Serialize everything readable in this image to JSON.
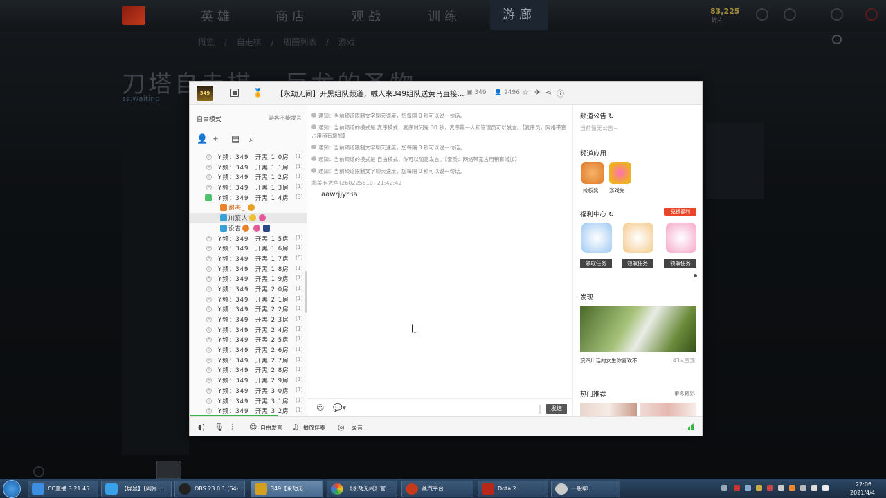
{
  "game": {
    "nav": [
      "英雄",
      "商店",
      "观战",
      "训练",
      "游廊"
    ],
    "active_nav": "游廊",
    "currency": "83,225",
    "currency_sub": "碎片",
    "breadcrumb": "概览 / 自走棋 / 周围列表 / 游戏",
    "title": "刀塔自走棋 - 巨龙的圣物",
    "subtitle": "ss.waiting"
  },
  "chat": {
    "channel_logo_text": "349",
    "channel_title": "【永劫无间】开黑组队频道，喊人来349组队送黄马直接...",
    "channel_id": "349",
    "online_count": "2496",
    "mode_label": "自由模式",
    "guest_label": "游客不能发言",
    "tree_rows": [
      {
        "name": "Y频：349　开黑 1 0房",
        "count": "(1)"
      },
      {
        "name": "Y频：349　开黑 1 1房",
        "count": "(1)"
      },
      {
        "name": "Y频：349　开黑 1 2房",
        "count": "(1)"
      },
      {
        "name": "Y频：349　开黑 1 3房",
        "count": "(1)"
      },
      {
        "name": "Y频：349　开黑 1 4房",
        "count": "(3)"
      },
      {
        "name": "谢老_",
        "count": ""
      },
      {
        "name": "川菜人",
        "count": ""
      },
      {
        "name": "设吉",
        "count": ""
      },
      {
        "name": "Y频：349　开黑 1 5房",
        "count": "(1)"
      },
      {
        "name": "Y频：349　开黑 1 6房",
        "count": "(1)"
      },
      {
        "name": "Y频：349　开黑 1 7房",
        "count": "(5)"
      },
      {
        "name": "Y频：349　开黑 1 8房",
        "count": "(1)"
      },
      {
        "name": "Y频：349　开黑 1 9房",
        "count": "(1)"
      },
      {
        "name": "Y频：349　开黑 2 0房",
        "count": "(1)"
      },
      {
        "name": "Y频：349　开黑 2 1房",
        "count": "(1)"
      },
      {
        "name": "Y频：349　开黑 2 2房",
        "count": "(1)"
      },
      {
        "name": "Y频：349　开黑 2 3房",
        "count": "(1)"
      },
      {
        "name": "Y频：349　开黑 2 4房",
        "count": "(1)"
      },
      {
        "name": "Y频：349　开黑 2 5房",
        "count": "(1)"
      },
      {
        "name": "Y频：349　开黑 2 6房",
        "count": "(1)"
      },
      {
        "name": "Y频：349　开黑 2 7房",
        "count": "(1)"
      },
      {
        "name": "Y频：349　开黑 2 8房",
        "count": "(1)"
      },
      {
        "name": "Y频：349　开黑 2 9房",
        "count": "(1)"
      },
      {
        "name": "Y频：349　开黑 3 0房",
        "count": "(1)"
      },
      {
        "name": "Y频：349　开黑 3 1房",
        "count": "(1)"
      },
      {
        "name": "Y频：349　开黑 3 2房",
        "count": "(1)"
      }
    ],
    "notices": [
      "通知：当前频道限制文字聊天速度，您每隔 0 秒可以说一句话。",
      "通知：当前频道的模式是 麦序模式，麦序时间是 30 秒，麦序第一人和管理员可以发言。【麦序员，网络带宽占用稍有增加】",
      "通知：当前频道限制文字聊天速度，您每隔 3 秒可以说一句话。",
      "通知：当前频道的模式是 自由模式，你可以随意发言。【音质：网络带宽占用稍有增加】",
      "通知：当前频道限制文字聊天速度，您每隔 0 秒可以说一句话。"
    ],
    "message_meta": "北美有大鱼(260225810) 21:42:42",
    "message_text": "aawrjjyr3a",
    "send_label": "发送",
    "announcement_title": "频道公告",
    "announcement_text": "当前暂无公告~",
    "apps_title": "频道应用",
    "apps": [
      "抢板凳",
      "游戏先..."
    ],
    "welfare_title": "福利中心",
    "welfare_button": "兑换福利",
    "task_labels": [
      "领取任务",
      "领取任务",
      "领取任务"
    ],
    "discover_title": "发现",
    "discover_caption": "浣四川话的女生你喜欢不",
    "discover_count": "43人围观",
    "hot_title": "热门推荐",
    "hot_more": "更多精彩",
    "footer": {
      "free_speak": "自由发言",
      "accompany": "播放伴奏",
      "record": "录音"
    }
  },
  "taskbar": {
    "items": [
      {
        "label": "CC直播 3.21.45",
        "color": "#3d8ee0"
      },
      {
        "label": "【屏显】【网易...",
        "color": "#3aa0e8"
      },
      {
        "label": "OBS 23.0.1 (64-...",
        "color": "#222222"
      },
      {
        "label": "349【永劫无...",
        "color": "#d4a020"
      },
      {
        "label": "《永劫无间》官...",
        "color": "#e04a2a"
      },
      {
        "label": "蒸汽平台",
        "color": "#c43a1a"
      },
      {
        "label": "Dota 2",
        "color": "#b8281a"
      },
      {
        "label": "一般聊...",
        "color": "#cccccc"
      }
    ],
    "time": "22:06",
    "date": "2021/4/4"
  }
}
